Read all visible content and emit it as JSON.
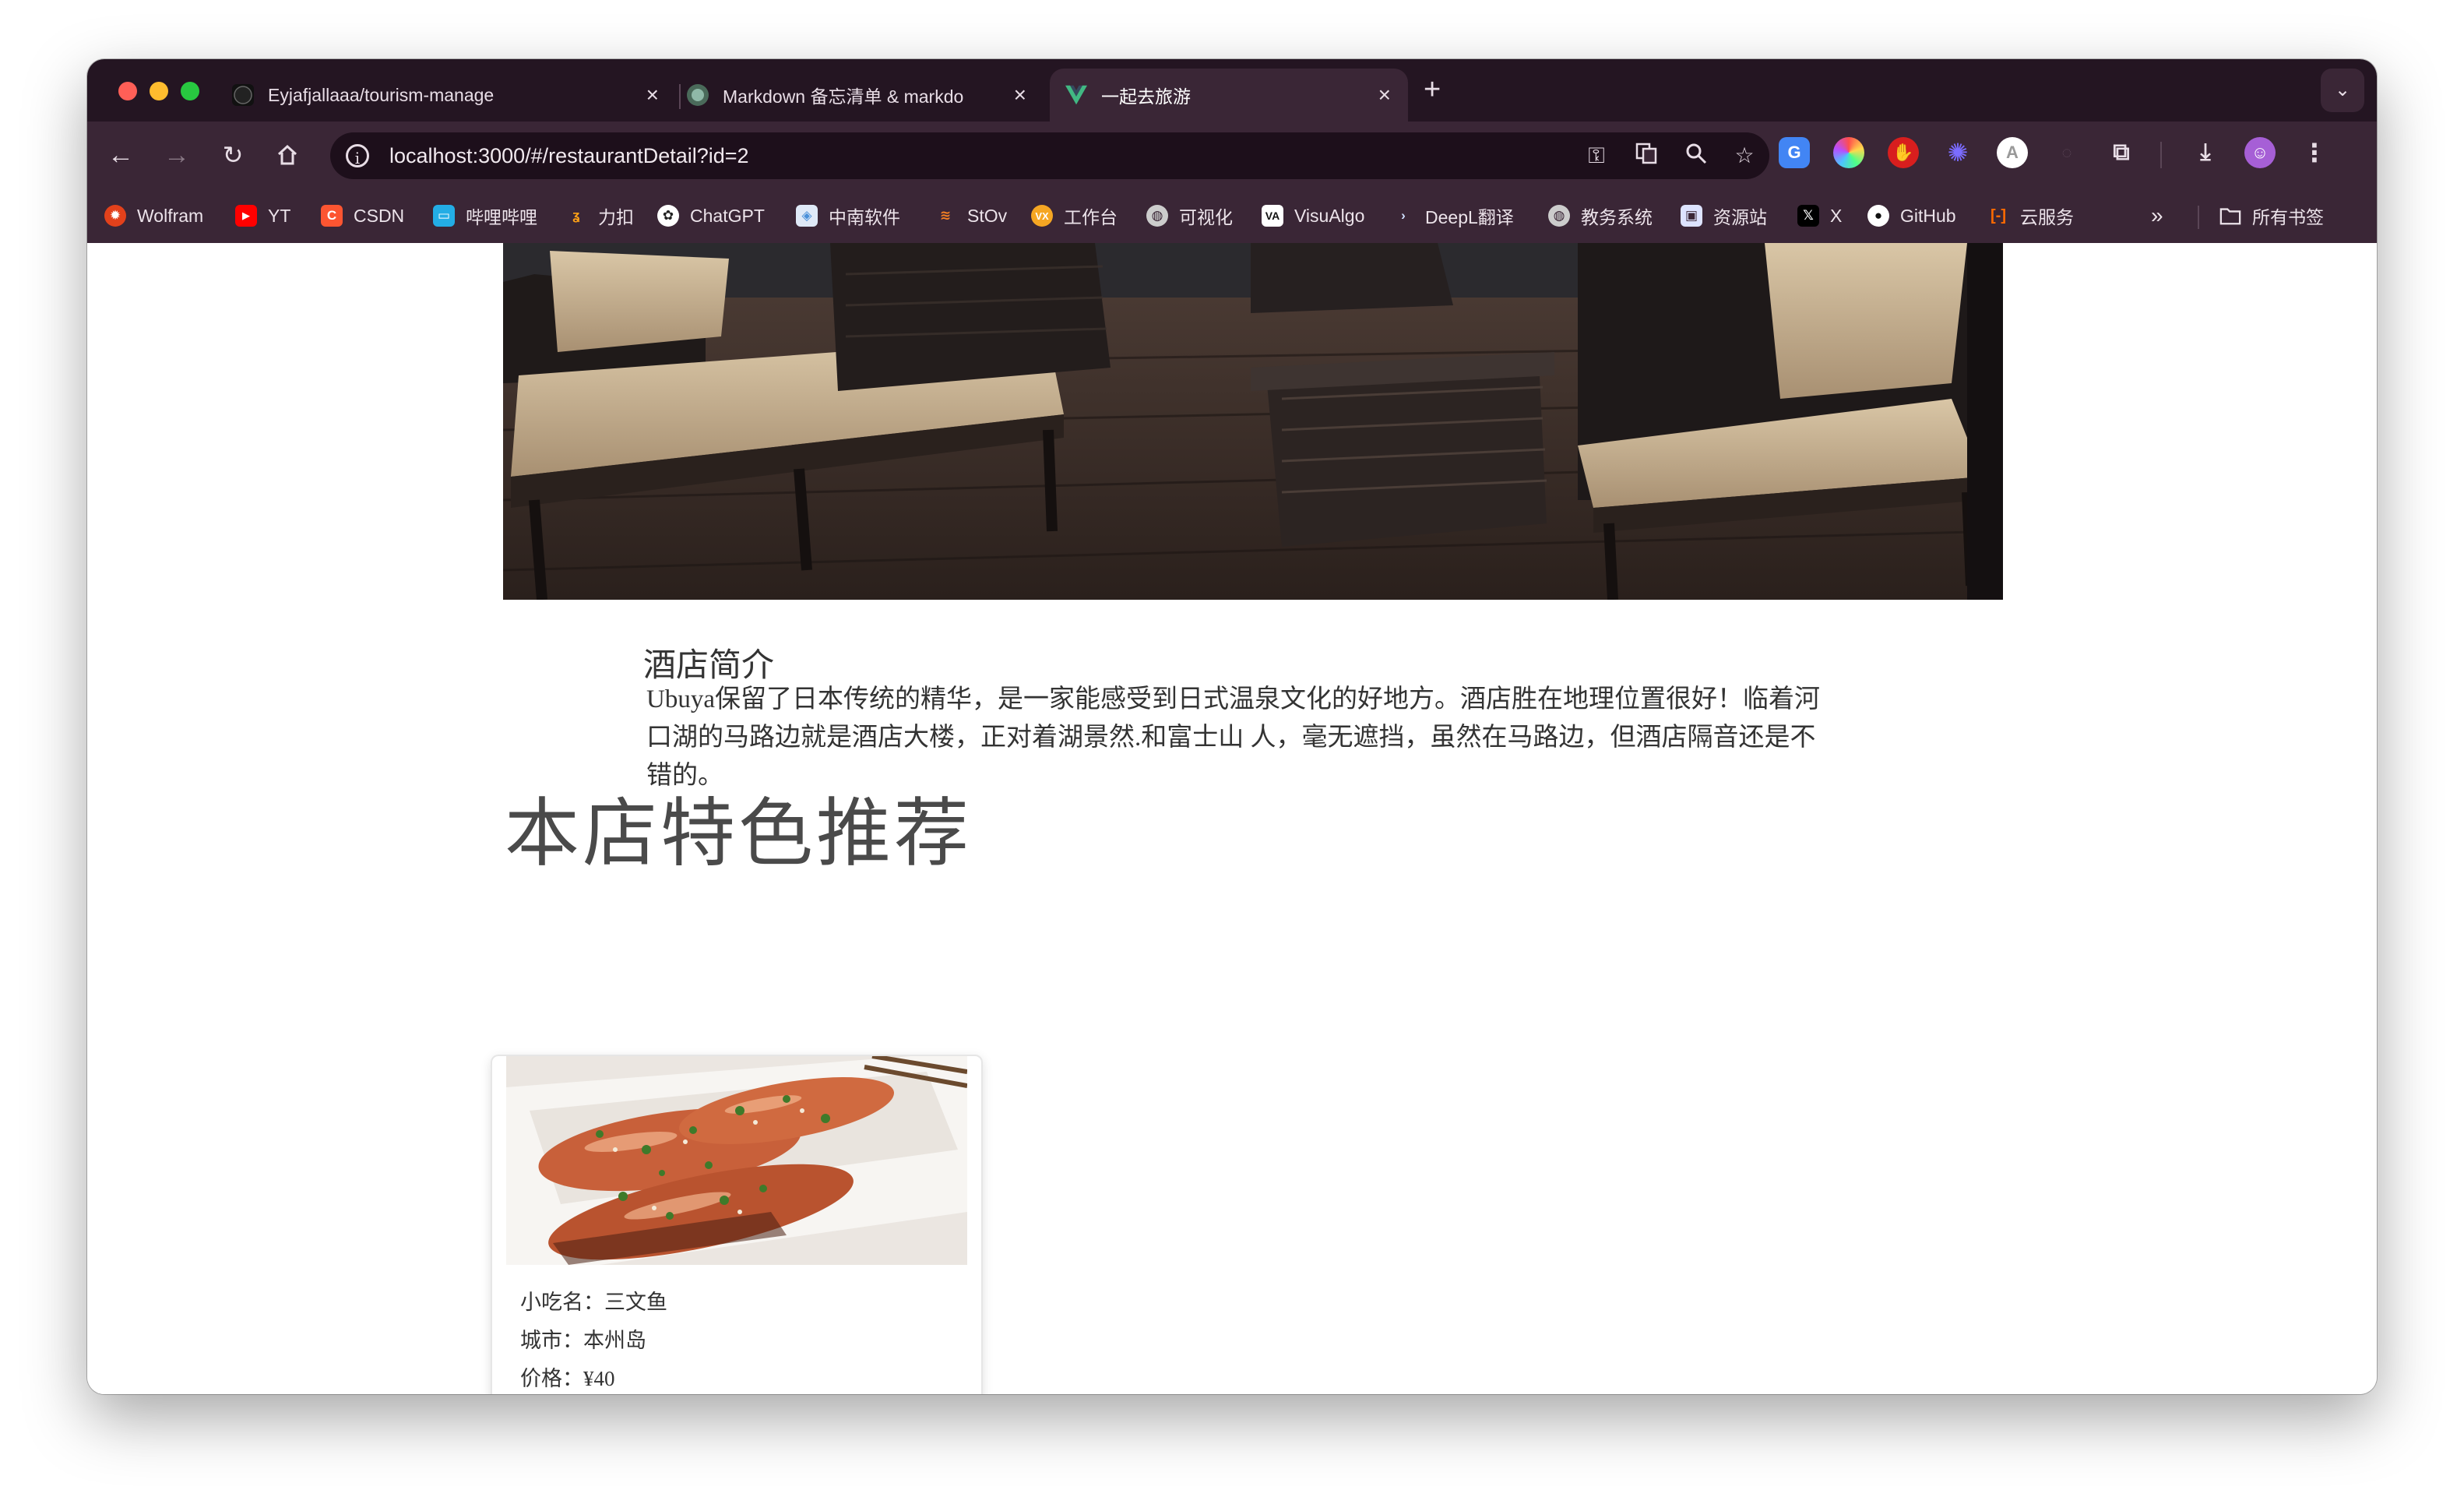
{
  "browser": {
    "tabs": [
      {
        "title": "Eyjafjallaaa/tourism-manage",
        "icon": "github-icon",
        "active": false
      },
      {
        "title": "Markdown 备忘清单 & markdo",
        "icon": "cheatsheet-icon",
        "active": false
      },
      {
        "title": "一起去旅游",
        "icon": "vue-icon",
        "active": true
      }
    ],
    "url": "localhost:3000/#/restaurantDetail?id=2",
    "bookmarks": [
      {
        "label": "Wolfram",
        "icon": "wolfram-icon",
        "color": "#e2411b"
      },
      {
        "label": "YT",
        "icon": "youtube-icon",
        "color": "#ff0000"
      },
      {
        "label": "CSDN",
        "icon": "csdn-icon",
        "color": "#fc5531"
      },
      {
        "label": "哔哩哔哩",
        "icon": "bilibili-icon",
        "color": "#23ade5"
      },
      {
        "label": "力扣",
        "icon": "leetcode-icon",
        "color": "#ffa116"
      },
      {
        "label": "ChatGPT",
        "icon": "chatgpt-icon",
        "color": "#ffffff"
      },
      {
        "label": "中南软件",
        "icon": "csu-icon",
        "color": "#4a90d9"
      },
      {
        "label": "StOv",
        "icon": "stackoverflow-icon",
        "color": "#f48024"
      },
      {
        "label": "工作台",
        "icon": "workbench-icon",
        "color": "#f5a623"
      },
      {
        "label": "可视化",
        "icon": "globe-icon",
        "color": "#cccccc"
      },
      {
        "label": "VisuAlgo",
        "icon": "visualgo-icon",
        "color": "#ffffff"
      },
      {
        "label": "DeepL翻译",
        "icon": "deepl-icon",
        "color": "#0f2b46"
      },
      {
        "label": "教务系统",
        "icon": "globe-icon",
        "color": "#cccccc"
      },
      {
        "label": "资源站",
        "icon": "resource-icon",
        "color": "#dde3ff"
      },
      {
        "label": "X",
        "icon": "x-icon",
        "color": "#000000"
      },
      {
        "label": "GitHub",
        "icon": "github-icon",
        "color": "#ffffff"
      },
      {
        "label": "云服务",
        "icon": "cloud-icon",
        "color": "#ff6a00"
      }
    ],
    "all_bookmarks": "所有书签"
  },
  "page": {
    "intro_title": "酒店简介",
    "intro_text": "Ubuya保留了日本传统的精华，是一家能感受到日式温泉文化的好地方。酒店胜在地理位置很好！临着河口湖的马路边就是酒店大楼，正对着湖景然.和富士山 人，毫无遮挡，虽然在马路边，但酒店隔音还是不错的。",
    "featured_title": "本店特色推荐",
    "dishes": [
      {
        "name_line": "小吃名：三文鱼",
        "city_line": "城市：本州岛",
        "price_line": "价格：¥40"
      }
    ]
  }
}
